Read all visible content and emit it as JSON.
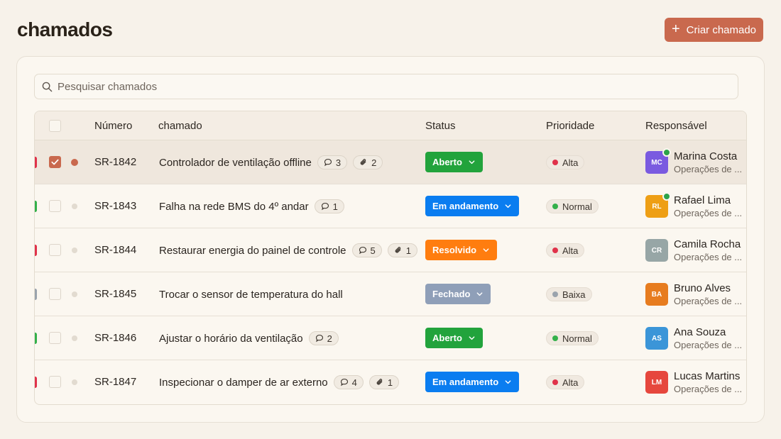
{
  "page": {
    "title": "chamados"
  },
  "toolbar": {
    "create_label": "Criar chamado"
  },
  "search": {
    "placeholder": "Pesquisar chamados"
  },
  "table": {
    "headers": {
      "number": "Número",
      "title": "chamado",
      "status": "Status",
      "priority": "Prioridade",
      "assignee": "Responsável"
    },
    "rows": [
      {
        "number": "SR-1842",
        "title": "Controlador de ventilação offline",
        "comments": "3",
        "attachments": "2",
        "status": "Aberto",
        "status_color": "#22a33c",
        "priority": "Alta",
        "priority_color": "#e0324a",
        "stripe_color": "#e0324a",
        "selected": true,
        "unread": true,
        "assignee": {
          "initials": "MC",
          "name": "Marina Costa",
          "team": "Operações de ...",
          "color": "#7a5ae0",
          "online": true
        }
      },
      {
        "number": "SR-1843",
        "title": "Falha na rede BMS do 4º andar",
        "comments": "1",
        "attachments": null,
        "status": "Em andamento",
        "status_color": "#0a7df0",
        "priority": "Normal",
        "priority_color": "#33b04a",
        "stripe_color": "#33b04a",
        "selected": false,
        "unread": false,
        "assignee": {
          "initials": "RL",
          "name": "Rafael Lima",
          "team": "Operações de ...",
          "color": "#ee9f15",
          "online": true
        }
      },
      {
        "number": "SR-1844",
        "title": "Restaurar energia do painel de controle",
        "comments": "5",
        "attachments": "1",
        "status": "Resolvido",
        "status_color": "#ff7d0f",
        "priority": "Alta",
        "priority_color": "#e0324a",
        "stripe_color": "#e0324a",
        "selected": false,
        "unread": false,
        "assignee": {
          "initials": "CR",
          "name": "Camila Rocha",
          "team": "Operações de ...",
          "color": "#97a6a6",
          "online": false
        }
      },
      {
        "number": "SR-1845",
        "title": "Trocar o sensor de temperatura do hall",
        "comments": null,
        "attachments": null,
        "status": "Fechado",
        "status_color": "#8f9fb8",
        "priority": "Baixa",
        "priority_color": "#9aa3ad",
        "stripe_color": "#9aa3ad",
        "selected": false,
        "unread": false,
        "assignee": {
          "initials": "BA",
          "name": "Bruno Alves",
          "team": "Operações de ...",
          "color": "#e77c1f",
          "online": false
        }
      },
      {
        "number": "SR-1846",
        "title": "Ajustar o horário da ventilação",
        "comments": "2",
        "attachments": null,
        "status": "Aberto",
        "status_color": "#22a33c",
        "priority": "Normal",
        "priority_color": "#33b04a",
        "stripe_color": "#33b04a",
        "selected": false,
        "unread": false,
        "assignee": {
          "initials": "AS",
          "name": "Ana Souza",
          "team": "Operações de ...",
          "color": "#3b95d8",
          "online": false
        }
      },
      {
        "number": "SR-1847",
        "title": "Inspecionar o damper de ar externo",
        "comments": "4",
        "attachments": "1",
        "status": "Em andamento",
        "status_color": "#0a7df0",
        "priority": "Alta",
        "priority_color": "#e0324a",
        "stripe_color": "#e0324a",
        "selected": false,
        "unread": false,
        "assignee": {
          "initials": "LM",
          "name": "Lucas Martins",
          "team": "Operações de ...",
          "color": "#e6473d",
          "online": false
        }
      }
    ]
  }
}
